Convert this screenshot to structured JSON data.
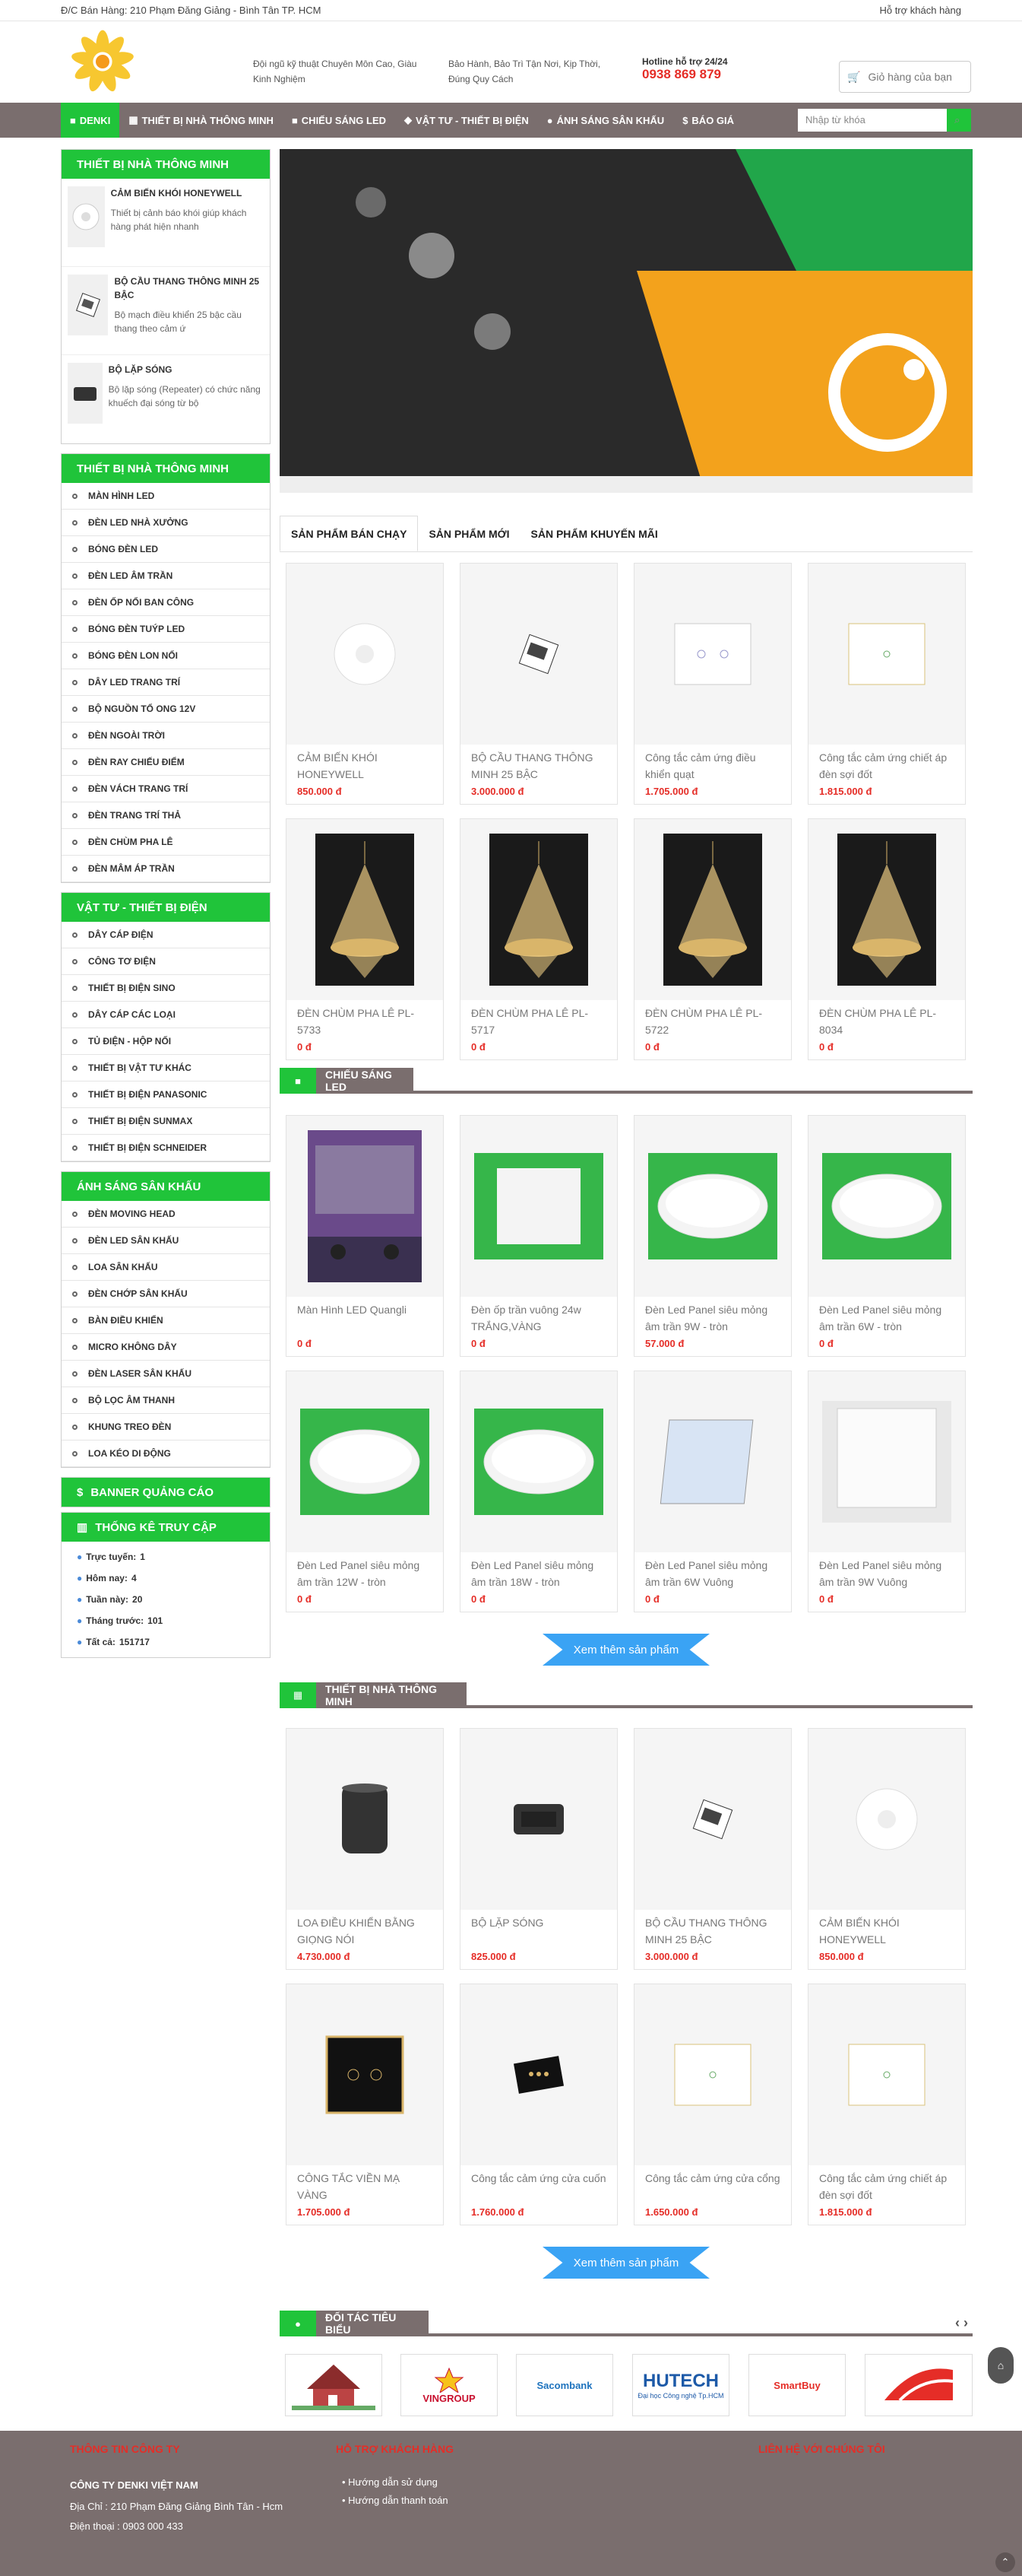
{
  "top": {
    "address": "Đ/C Bán Hàng: 210 Phạm Đăng Giảng - Bình Tân TP. HCM",
    "support": "Hỗ trợ khách hàng"
  },
  "header": {
    "info1": "Đội ngũ kỹ thuật Chuyên Môn Cao, Giàu Kinh Nghiệm",
    "info2": "Bảo Hành, Bảo Trì Tận Nơi, Kịp Thời, Đúng Quy Cách",
    "hotline_label": "Hotline hỗ trợ 24/24",
    "hotline": "0938 869 879",
    "cart": "Giỏ hàng của bạn"
  },
  "nav": {
    "items": [
      "DENKI",
      "THIẾT BỊ NHÀ THÔNG MINH",
      "CHIẾU SÁNG LED",
      "VẬT TƯ - THIẾT BỊ ĐIỆN",
      "ÁNH SÁNG SÂN KHẤU",
      "BÁO GIÁ"
    ],
    "search_placeholder": "Nhập từ khóa"
  },
  "side": {
    "featured_title": "THIẾT BỊ NHÀ THÔNG MINH",
    "featured": [
      {
        "name": "CẢM BIẾN KHÓI HONEYWELL",
        "desc": "Thiết bị cảnh báo khói giúp khách hàng phát hiện nhanh"
      },
      {
        "name": "BỘ CẦU THANG THÔNG MINH 25 BẬC",
        "desc": "Bộ mạch điều khiển 25 bậc cầu thang theo cảm ứ"
      },
      {
        "name": "BỘ LẶP SÓNG",
        "desc": "Bộ lặp sóng (Repeater) có chức năng khuếch đại sóng từ bộ"
      }
    ],
    "cat1_title": "THIẾT BỊ NHÀ THÔNG MINH",
    "cat1": [
      "MÀN HÌNH LED",
      "ĐÈN LED NHÀ XƯỞNG",
      "BÓNG ĐÈN LED",
      "ĐÈN LED ÂM TRẦN",
      "ĐÈN ỐP NỔI BAN CÔNG",
      "BÓNG ĐÈN TUÝP LED",
      "BÓNG ĐÈN LON NỔI",
      "DÂY LED TRANG TRÍ",
      "BỘ NGUỒN TỔ ONG 12V",
      "ĐÈN NGOÀI TRỜI",
      "ĐÈN RAY CHIẾU ĐIỂM",
      "ĐÈN VÁCH TRANG TRÍ",
      "ĐÈN TRANG TRÍ THẢ",
      "ĐÈN CHÙM PHA LÊ",
      "ĐÈN MÂM ÁP TRẦN"
    ],
    "cat2_title": "VẬT TƯ - THIẾT BỊ ĐIỆN",
    "cat2": [
      "DÂY CÁP ĐIỆN",
      "CÔNG TƠ ĐIỆN",
      "THIẾT BỊ ĐIỆN SINO",
      "DÂY CÁP CÁC LOẠI",
      "TỦ ĐIỆN - HỘP NỐI",
      "THIẾT BỊ VẬT TƯ KHÁC",
      "THIẾT BỊ ĐIỆN PANASONIC",
      "THIẾT BỊ ĐIỆN SUNMAX",
      "THIẾT BỊ ĐIỆN SCHNEIDER"
    ],
    "cat3_title": "ÁNH SÁNG SÂN KHẤU",
    "cat3": [
      "ĐÈN MOVING HEAD",
      "ĐÈN LED SÂN KHẤU",
      "LOA SÂN KHẤU",
      "ĐÈN CHỚP SÂN KHẤU",
      "BÀN ĐIỀU KHIỂN",
      "MICRO KHÔNG DÂY",
      "ĐÈN LASER SÂN KHẤU",
      "BỘ LỌC ÂM THANH",
      "KHUNG TREO ĐÈN",
      "LOA KÉO DI ĐỘNG"
    ],
    "banner_title": "BANNER QUẢNG CÁO",
    "stats_title": "THỐNG KÊ TRUY CẬP",
    "stats": [
      {
        "label": "Trực tuyến:",
        "value": "1"
      },
      {
        "label": "Hôm nay:",
        "value": "4"
      },
      {
        "label": "Tuần này:",
        "value": "20"
      },
      {
        "label": "Tháng trước:",
        "value": "101"
      },
      {
        "label": "Tất cả:",
        "value": "151717"
      }
    ]
  },
  "tabs": [
    "SẢN PHẨM BÁN CHẠY",
    "SẢN PHẨM MỚI",
    "SẢN PHẨM KHUYẾN MÃI"
  ],
  "grid1": [
    {
      "name": "CẢM BIẾN KHÓI HONEYWELL",
      "price": "850.000 đ"
    },
    {
      "name": "BỘ CẦU THANG THÔNG MINH 25 BẬC",
      "price": "3.000.000 đ"
    },
    {
      "name": "Công tắc cảm ứng điều khiển quạt",
      "price": "1.705.000 đ"
    },
    {
      "name": "Công tắc cảm ứng chiết áp đèn sợi đốt",
      "price": "1.815.000 đ"
    },
    {
      "name": "ĐÈN CHÙM PHA LÊ PL-5733",
      "price": "0 đ"
    },
    {
      "name": "ĐÈN CHÙM PHA LÊ PL-5717",
      "price": "0 đ"
    },
    {
      "name": "ĐÈN CHÙM PHA LÊ PL-5722",
      "price": "0 đ"
    },
    {
      "name": "ĐÈN CHÙM PHA LÊ PL-8034",
      "price": "0 đ"
    }
  ],
  "sec1": "CHIẾU SÁNG LED",
  "grid2": [
    {
      "name": "Màn Hình LED Quangli",
      "price": "0 đ"
    },
    {
      "name": "Đèn ốp trần vuông 24w TRẮNG,VÀNG",
      "price": "0 đ"
    },
    {
      "name": "Đèn Led Panel siêu mỏng âm trần 9W - tròn",
      "price": "57.000 đ"
    },
    {
      "name": "Đèn Led Panel siêu mỏng âm trần 6W - tròn",
      "price": "0 đ"
    },
    {
      "name": "Đèn Led Panel siêu mỏng âm trần 12W - tròn",
      "price": "0 đ"
    },
    {
      "name": "Đèn Led Panel siêu mỏng âm trần 18W - tròn",
      "price": "0 đ"
    },
    {
      "name": "Đèn Led Panel siêu mỏng âm trần 6W Vuông",
      "price": "0 đ"
    },
    {
      "name": "Đèn Led Panel siêu mỏng âm trần 9W Vuông",
      "price": "0 đ"
    }
  ],
  "more": "Xem thêm sản phẩm",
  "sec2": "THIẾT BỊ NHÀ THÔNG MINH",
  "grid3": [
    {
      "name": "LOA ĐIỀU KHIỂN BẰNG GIỌNG NÓI",
      "price": "4.730.000 đ"
    },
    {
      "name": "BỘ LẶP SÓNG",
      "price": "825.000 đ"
    },
    {
      "name": "BỘ CẦU THANG THÔNG MINH 25 BẬC",
      "price": "3.000.000 đ"
    },
    {
      "name": "CẢM BIẾN KHÓI HONEYWELL",
      "price": "850.000 đ"
    },
    {
      "name": "CÔNG TẮC VIỀN MẠ VÀNG",
      "price": "1.705.000 đ"
    },
    {
      "name": "Công tắc cảm ứng cửa cuốn",
      "price": "1.760.000 đ"
    },
    {
      "name": "Công tắc cảm ứng cửa cổng",
      "price": "1.650.000 đ"
    },
    {
      "name": "Công tắc cảm ứng chiết áp đèn sợi đốt",
      "price": "1.815.000 đ"
    }
  ],
  "sec3": "ĐỐI TÁC TIÊU BIỂU",
  "partners": [
    "VINGROUP",
    "Sacombank",
    "HUTECH",
    "SmartBuy"
  ],
  "partner_sub": "Đại học Công nghệ Tp.HCM",
  "footer": {
    "col1_title": "THÔNG TIN CÔNG TY",
    "company": "CÔNG TY DENKI VIỆT NAM",
    "address": "Địa Chỉ : 210 Phạm Đăng Giảng Bình Tân - Hcm",
    "phone": "Điện thoại : 0903 000 433",
    "col2_title": "HỖ TRỢ KHÁCH HÀNG",
    "links": [
      "Hướng dẫn sử dụng",
      "Hướng dẫn thanh toán"
    ],
    "col3_title": "LIÊN HỆ VỚI CHÚNG TÔI"
  },
  "colors": {
    "accent": "#20c43a",
    "nav": "#7a6e6e",
    "price": "#e52d27"
  }
}
